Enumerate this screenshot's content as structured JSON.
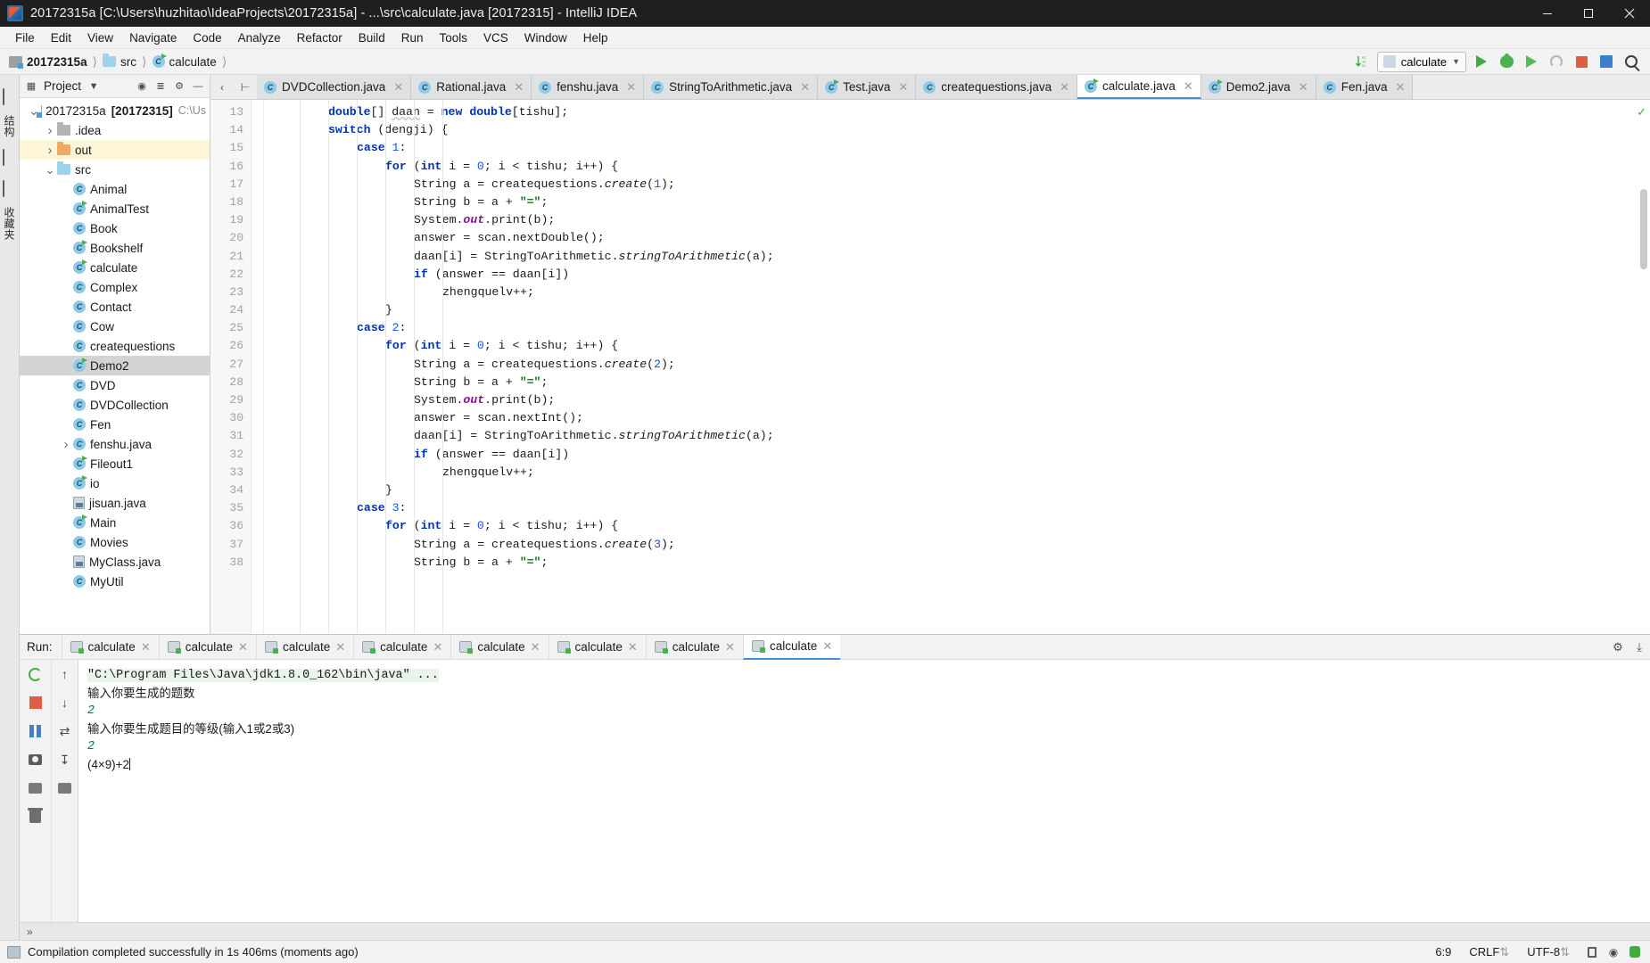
{
  "window": {
    "title": "20172315a [C:\\Users\\huzhitao\\IdeaProjects\\20172315a] - ...\\src\\calculate.java [20172315] - IntelliJ IDEA",
    "app_icon": "intellij-idea-icon",
    "minimize": "minimize-icon",
    "maximize": "maximize-icon",
    "close": "close-icon"
  },
  "menubar": [
    {
      "label": "File"
    },
    {
      "label": "Edit"
    },
    {
      "label": "View"
    },
    {
      "label": "Navigate"
    },
    {
      "label": "Code"
    },
    {
      "label": "Analyze"
    },
    {
      "label": "Refactor"
    },
    {
      "label": "Build"
    },
    {
      "label": "Run"
    },
    {
      "label": "Tools"
    },
    {
      "label": "VCS"
    },
    {
      "label": "Window"
    },
    {
      "label": "Help"
    }
  ],
  "navbar": {
    "breadcrumb": [
      {
        "label": "20172315a",
        "icon": "project-icon",
        "bold": true
      },
      {
        "label": "src",
        "icon": "folder-icon",
        "bold": false
      },
      {
        "label": "calculate",
        "icon": "java-class-icon",
        "bold": false
      }
    ],
    "run_config": "calculate",
    "icons": {
      "sort": "sort-numeric-icon",
      "run": "run-icon",
      "debug": "debug-icon",
      "coverage": "run-with-coverage-icon",
      "profile": "profile-icon",
      "stop": "stop-icon",
      "structure": "project-structure-icon",
      "search": "search-everywhere-icon"
    }
  },
  "left_rail": {
    "labels": [
      "结构",
      "收藏夹"
    ],
    "icons": [
      "project-tool-icon",
      "structure-tool-icon"
    ]
  },
  "project_panel": {
    "title": "Project",
    "header_icons": [
      "project-view-dropdown-icon",
      "locate-icon",
      "collapse-all-icon",
      "settings-gear-icon",
      "hide-icon"
    ],
    "tree": [
      {
        "label": "20172315a",
        "suffix": "[20172315]",
        "trail": "C:\\Us",
        "icon": "project-icon",
        "arrow": "expanded",
        "depth": 0,
        "bold_suffix": true,
        "state": "normal"
      },
      {
        "label": ".idea",
        "icon": "folder-gray-icon",
        "arrow": "collapsed",
        "depth": 1,
        "state": "normal"
      },
      {
        "label": "out",
        "icon": "folder-orange-icon",
        "arrow": "collapsed",
        "depth": 1,
        "state": "highlight"
      },
      {
        "label": "src",
        "icon": "folder-blue-icon",
        "arrow": "expanded",
        "depth": 1,
        "state": "normal"
      },
      {
        "label": "Animal",
        "icon": "java-class-icon",
        "arrow": "none",
        "depth": 2,
        "state": "normal"
      },
      {
        "label": "AnimalTest",
        "icon": "java-class-runnable-icon",
        "arrow": "none",
        "depth": 2,
        "state": "normal"
      },
      {
        "label": "Book",
        "icon": "java-class-icon",
        "arrow": "none",
        "depth": 2,
        "state": "normal"
      },
      {
        "label": "Bookshelf",
        "icon": "java-class-runnable-icon",
        "arrow": "none",
        "depth": 2,
        "state": "normal"
      },
      {
        "label": "calculate",
        "icon": "java-class-runnable-icon",
        "arrow": "none",
        "depth": 2,
        "state": "normal"
      },
      {
        "label": "Complex",
        "icon": "java-class-icon",
        "arrow": "none",
        "depth": 2,
        "state": "normal"
      },
      {
        "label": "Contact",
        "icon": "java-class-icon",
        "arrow": "none",
        "depth": 2,
        "state": "normal"
      },
      {
        "label": "Cow",
        "icon": "java-class-icon",
        "arrow": "none",
        "depth": 2,
        "state": "normal"
      },
      {
        "label": "createquestions",
        "icon": "java-class-icon",
        "arrow": "none",
        "depth": 2,
        "state": "normal"
      },
      {
        "label": "Demo2",
        "icon": "java-class-runnable-icon",
        "arrow": "none",
        "depth": 2,
        "state": "selected"
      },
      {
        "label": "DVD",
        "icon": "java-class-icon",
        "arrow": "none",
        "depth": 2,
        "state": "normal"
      },
      {
        "label": "DVDCollection",
        "icon": "java-class-icon",
        "arrow": "none",
        "depth": 2,
        "state": "normal"
      },
      {
        "label": "Fen",
        "icon": "java-class-icon",
        "arrow": "none",
        "depth": 2,
        "state": "normal"
      },
      {
        "label": "fenshu.java",
        "icon": "java-class-icon",
        "arrow": "collapsed",
        "depth": 2,
        "state": "normal"
      },
      {
        "label": "Fileout1",
        "icon": "java-class-runnable-icon",
        "arrow": "none",
        "depth": 2,
        "state": "normal"
      },
      {
        "label": "io",
        "icon": "java-class-runnable-icon",
        "arrow": "none",
        "depth": 2,
        "state": "normal"
      },
      {
        "label": "jisuan.java",
        "icon": "java-file-icon",
        "arrow": "none",
        "depth": 2,
        "state": "normal"
      },
      {
        "label": "Main",
        "icon": "java-class-runnable-icon",
        "arrow": "none",
        "depth": 2,
        "state": "normal"
      },
      {
        "label": "Movies",
        "icon": "java-class-icon",
        "arrow": "none",
        "depth": 2,
        "state": "normal"
      },
      {
        "label": "MyClass.java",
        "icon": "java-file-icon",
        "arrow": "none",
        "depth": 2,
        "state": "normal"
      },
      {
        "label": "MyUtil",
        "icon": "java-class-icon",
        "arrow": "none",
        "depth": 2,
        "state": "normal"
      }
    ]
  },
  "editor": {
    "tabs": [
      {
        "label": "DVDCollection.java",
        "icon": "java-class-icon",
        "active": false
      },
      {
        "label": "Rational.java",
        "icon": "java-class-icon",
        "active": false
      },
      {
        "label": "fenshu.java",
        "icon": "java-class-icon",
        "active": false
      },
      {
        "label": "StringToArithmetic.java",
        "icon": "java-class-icon",
        "active": false
      },
      {
        "label": "Test.java",
        "icon": "java-class-runnable-icon",
        "active": false
      },
      {
        "label": "createquestions.java",
        "icon": "java-class-icon",
        "active": false
      },
      {
        "label": "calculate.java",
        "icon": "java-class-runnable-icon",
        "active": true
      },
      {
        "label": "Demo2.java",
        "icon": "java-class-runnable-icon",
        "active": false
      },
      {
        "label": "Fen.java",
        "icon": "java-class-icon",
        "active": false
      }
    ],
    "first_line_number": 13,
    "lines": [
      {
        "n": 13,
        "indent": 2,
        "tokens": [
          {
            "t": "double",
            "c": "kw"
          },
          {
            "t": "[] ",
            "c": ""
          },
          {
            "t": "daan",
            "c": "und"
          },
          {
            "t": " = ",
            "c": ""
          },
          {
            "t": "new",
            "c": "kw"
          },
          {
            "t": " ",
            "c": ""
          },
          {
            "t": "double",
            "c": "kw"
          },
          {
            "t": "[tishu];",
            "c": ""
          }
        ]
      },
      {
        "n": 14,
        "indent": 2,
        "tokens": [
          {
            "t": "switch",
            "c": "kw"
          },
          {
            "t": " (dengji) {",
            "c": ""
          }
        ]
      },
      {
        "n": 15,
        "indent": 3,
        "tokens": [
          {
            "t": "case",
            "c": "kw"
          },
          {
            "t": " ",
            "c": ""
          },
          {
            "t": "1",
            "c": "num"
          },
          {
            "t": ":",
            "c": ""
          }
        ]
      },
      {
        "n": 16,
        "indent": 4,
        "tokens": [
          {
            "t": "for",
            "c": "kw"
          },
          {
            "t": " (",
            "c": ""
          },
          {
            "t": "int",
            "c": "kw"
          },
          {
            "t": " i = ",
            "c": ""
          },
          {
            "t": "0",
            "c": "num"
          },
          {
            "t": "; i < tishu; i++) {",
            "c": ""
          }
        ]
      },
      {
        "n": 17,
        "indent": 5,
        "tokens": [
          {
            "t": "String a = createquestions.",
            "c": ""
          },
          {
            "t": "create",
            "c": "mth"
          },
          {
            "t": "(",
            "c": ""
          },
          {
            "t": "1",
            "c": "num"
          },
          {
            "t": ");",
            "c": ""
          }
        ]
      },
      {
        "n": 18,
        "indent": 5,
        "tokens": [
          {
            "t": "String b = a + ",
            "c": ""
          },
          {
            "t": "\"=\"",
            "c": "str"
          },
          {
            "t": ";",
            "c": ""
          }
        ]
      },
      {
        "n": 19,
        "indent": 5,
        "tokens": [
          {
            "t": "System.",
            "c": ""
          },
          {
            "t": "out",
            "c": "fld"
          },
          {
            "t": ".print(b);",
            "c": ""
          }
        ]
      },
      {
        "n": 20,
        "indent": 5,
        "tokens": [
          {
            "t": "answer = scan.nextDouble();",
            "c": ""
          }
        ]
      },
      {
        "n": 21,
        "indent": 5,
        "tokens": [
          {
            "t": "daan[i] = StringToArithmetic.",
            "c": ""
          },
          {
            "t": "stringToArithmetic",
            "c": "mth"
          },
          {
            "t": "(a);",
            "c": ""
          }
        ]
      },
      {
        "n": 22,
        "indent": 5,
        "tokens": [
          {
            "t": "if",
            "c": "kw"
          },
          {
            "t": " (answer == daan[i])",
            "c": ""
          }
        ]
      },
      {
        "n": 23,
        "indent": 6,
        "tokens": [
          {
            "t": "zhengquelv++;",
            "c": ""
          }
        ]
      },
      {
        "n": 24,
        "indent": 4,
        "tokens": [
          {
            "t": "}",
            "c": ""
          }
        ]
      },
      {
        "n": 25,
        "indent": 3,
        "tokens": [
          {
            "t": "case",
            "c": "kw"
          },
          {
            "t": " ",
            "c": ""
          },
          {
            "t": "2",
            "c": "num"
          },
          {
            "t": ":",
            "c": ""
          }
        ]
      },
      {
        "n": 26,
        "indent": 4,
        "tokens": [
          {
            "t": "for",
            "c": "kw"
          },
          {
            "t": " (",
            "c": ""
          },
          {
            "t": "int",
            "c": "kw"
          },
          {
            "t": " i = ",
            "c": ""
          },
          {
            "t": "0",
            "c": "num"
          },
          {
            "t": "; i < tishu; i++) {",
            "c": ""
          }
        ]
      },
      {
        "n": 27,
        "indent": 5,
        "tokens": [
          {
            "t": "String a = createquestions.",
            "c": ""
          },
          {
            "t": "create",
            "c": "mth"
          },
          {
            "t": "(",
            "c": ""
          },
          {
            "t": "2",
            "c": "num"
          },
          {
            "t": ");",
            "c": ""
          }
        ]
      },
      {
        "n": 28,
        "indent": 5,
        "tokens": [
          {
            "t": "String b = a + ",
            "c": ""
          },
          {
            "t": "\"=\"",
            "c": "str"
          },
          {
            "t": ";",
            "c": ""
          }
        ]
      },
      {
        "n": 29,
        "indent": 5,
        "tokens": [
          {
            "t": "System.",
            "c": ""
          },
          {
            "t": "out",
            "c": "fld"
          },
          {
            "t": ".print(b);",
            "c": ""
          }
        ]
      },
      {
        "n": 30,
        "indent": 5,
        "tokens": [
          {
            "t": "answer = scan.nextInt();",
            "c": ""
          }
        ]
      },
      {
        "n": 31,
        "indent": 5,
        "tokens": [
          {
            "t": "daan[i] = StringToArithmetic.",
            "c": ""
          },
          {
            "t": "stringToArithmetic",
            "c": "mth"
          },
          {
            "t": "(a);",
            "c": ""
          }
        ]
      },
      {
        "n": 32,
        "indent": 5,
        "tokens": [
          {
            "t": "if",
            "c": "kw"
          },
          {
            "t": " (answer == daan[i])",
            "c": ""
          }
        ]
      },
      {
        "n": 33,
        "indent": 6,
        "tokens": [
          {
            "t": "zhengquelv++;",
            "c": ""
          }
        ]
      },
      {
        "n": 34,
        "indent": 4,
        "tokens": [
          {
            "t": "}",
            "c": ""
          }
        ]
      },
      {
        "n": 35,
        "indent": 3,
        "tokens": [
          {
            "t": "case",
            "c": "kw"
          },
          {
            "t": " ",
            "c": ""
          },
          {
            "t": "3",
            "c": "num"
          },
          {
            "t": ":",
            "c": ""
          }
        ]
      },
      {
        "n": 36,
        "indent": 4,
        "tokens": [
          {
            "t": "for",
            "c": "kw"
          },
          {
            "t": " (",
            "c": ""
          },
          {
            "t": "int",
            "c": "kw"
          },
          {
            "t": " i = ",
            "c": ""
          },
          {
            "t": "0",
            "c": "num"
          },
          {
            "t": "; i < tishu; i++) {",
            "c": ""
          }
        ]
      },
      {
        "n": 37,
        "indent": 5,
        "tokens": [
          {
            "t": "String a = createquestions.",
            "c": ""
          },
          {
            "t": "create",
            "c": "mth"
          },
          {
            "t": "(",
            "c": ""
          },
          {
            "t": "3",
            "c": "num"
          },
          {
            "t": ");",
            "c": ""
          }
        ]
      },
      {
        "n": 38,
        "indent": 5,
        "tokens": [
          {
            "t": "String b = a + ",
            "c": ""
          },
          {
            "t": "\"=\"",
            "c": "str"
          },
          {
            "t": ";",
            "c": ""
          }
        ]
      }
    ],
    "inspection_status": "ok-check-icon"
  },
  "run_panel": {
    "label": "Run:",
    "tabs": [
      {
        "label": "calculate",
        "active": false
      },
      {
        "label": "calculate",
        "active": false
      },
      {
        "label": "calculate",
        "active": false
      },
      {
        "label": "calculate",
        "active": false
      },
      {
        "label": "calculate",
        "active": false
      },
      {
        "label": "calculate",
        "active": false
      },
      {
        "label": "calculate",
        "active": false
      },
      {
        "label": "calculate",
        "active": true
      }
    ],
    "header_icons": [
      "settings-gear-icon",
      "hide-icon"
    ],
    "toolbar_icons": [
      "rerun-icon",
      "stop-icon",
      "pause-icon",
      "screenshot-icon",
      "print-icon",
      "trash-icon"
    ],
    "toolbar_icons2": [
      "scroll-up-icon",
      "scroll-down-icon",
      "soft-wrap-icon",
      "scroll-to-end-icon",
      "print-icon"
    ],
    "console_lines": [
      {
        "text": "\"C:\\Program Files\\Java\\jdk1.8.0_162\\bin\\java\" ...",
        "style": "cmd"
      },
      {
        "text": "输入你要生成的题数",
        "style": "cn"
      },
      {
        "text": "2",
        "style": "input"
      },
      {
        "text": "输入你要生成题目的等级(输入1或2或3)",
        "style": "cn"
      },
      {
        "text": "2",
        "style": "input"
      },
      {
        "text": "(4×9)+2",
        "style": "cn-caret"
      }
    ]
  },
  "statusbar": {
    "message": "Compilation completed successfully in 1s 406ms (moments ago)",
    "caret_position": "6:9",
    "line_separator": "CRLF",
    "encoding": "UTF-8",
    "icons": [
      "event-log-icon",
      "lock-icon",
      "inspection-icon",
      "memory-icon"
    ]
  }
}
